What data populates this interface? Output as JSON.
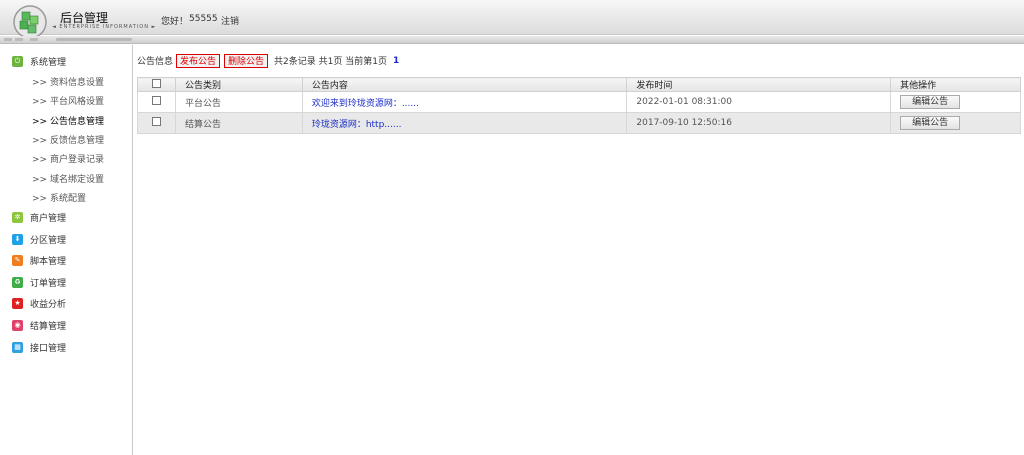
{
  "header": {
    "title": "后台管理",
    "subtitle": "◄ ENTERPRISE INFORMATION ►",
    "greeting": "您好！",
    "username": "55555",
    "logout": "注销"
  },
  "sidebar": {
    "groups": [
      {
        "label": "系统管理",
        "icon": "power-icon",
        "color": "#6db33f"
      },
      {
        "label": "商户管理",
        "icon": "gear-icon",
        "color": "#8cc63f"
      },
      {
        "label": "分区管理",
        "icon": "download-icon",
        "color": "#1ea1e6"
      },
      {
        "label": "脚本管理",
        "icon": "pencil-icon",
        "color": "#f07d1f"
      },
      {
        "label": "订单管理",
        "icon": "recycle-icon",
        "color": "#3fae49"
      },
      {
        "label": "收益分析",
        "icon": "star-icon",
        "color": "#e02020"
      },
      {
        "label": "结算管理",
        "icon": "target-icon",
        "color": "#e0406a"
      },
      {
        "label": "接口管理",
        "icon": "grid-icon",
        "color": "#2fa0e0"
      }
    ],
    "sub_items": [
      ">> 资料信息设置",
      ">> 平台风格设置",
      ">> 公告信息管理",
      ">> 反馈信息管理",
      ">> 商户登录记录",
      ">> 域名绑定设置",
      ">> 系统配置"
    ]
  },
  "main": {
    "section_label": "公告信息",
    "publish_btn": "发布公告",
    "delete_btn": "删除公告",
    "pager_text": "共2条记录 共1页 当前第1页",
    "pager_page": "1",
    "columns": [
      "公告类别",
      "公告内容",
      "发布时间",
      "其他操作"
    ],
    "rows": [
      {
        "type": "平台公告",
        "content": "欢迎来到玲珑资源网：......",
        "time": "2022-01-01 08:31:00",
        "action": "编辑公告"
      },
      {
        "type": "结算公告",
        "content": "玲珑资源网：http......",
        "time": "2017-09-10 12:50:16",
        "action": "编辑公告"
      }
    ]
  }
}
